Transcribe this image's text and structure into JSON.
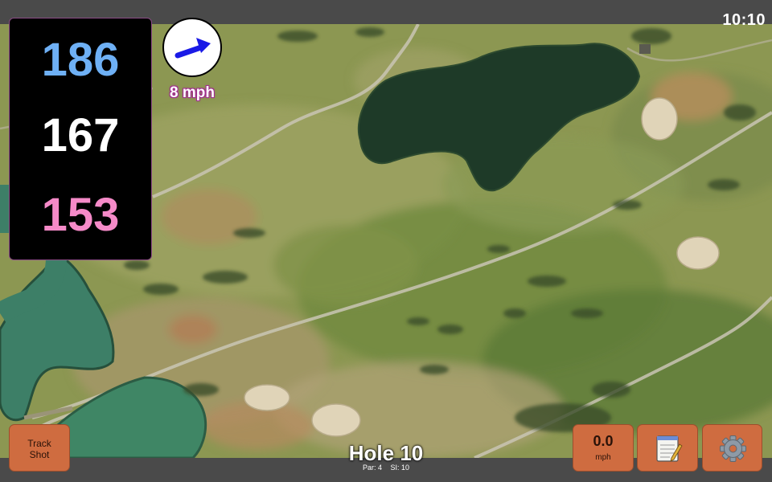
{
  "status": {
    "time": "10:10"
  },
  "distances": {
    "back": "186",
    "middle": "167",
    "front": "153"
  },
  "colors": {
    "back": "#6eb0f5",
    "middle": "#ffffff",
    "front": "#f58ac8",
    "button": "#cf6c40",
    "wind_arrow": "#1a1ae6"
  },
  "wind": {
    "speed": "8 mph",
    "arrow_icon": "wind-direction-arrow-icon"
  },
  "buttons": {
    "track_shot": "Track\nShot",
    "speed_value": "0.0",
    "speed_unit": "mph",
    "notes_icon": "notepad-icon",
    "settings_icon": "gear-icon"
  },
  "hole": {
    "title": "Hole 10",
    "par": "Par: 4",
    "si": "SI: 10"
  }
}
